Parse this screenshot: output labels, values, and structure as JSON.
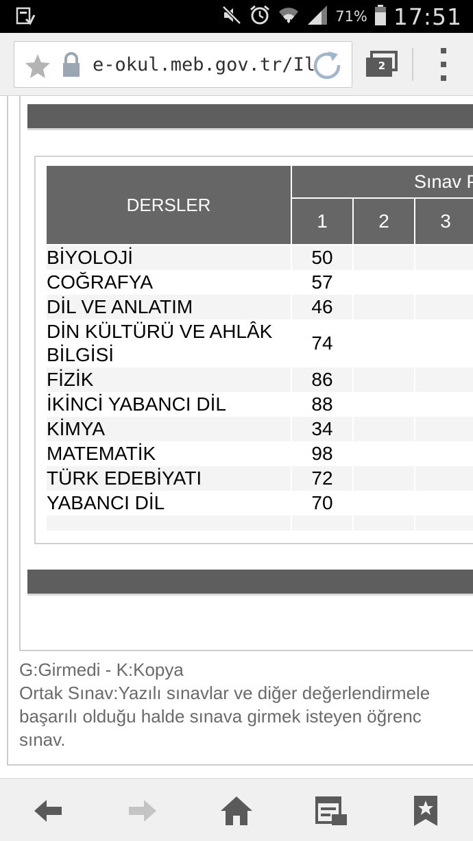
{
  "status_bar": {
    "battery_percent": "71%",
    "time": "17:51",
    "icons": [
      "screenshot-icon",
      "mute-icon",
      "alarm-icon",
      "wifi-icon",
      "signal-icon",
      "battery-icon"
    ]
  },
  "browser": {
    "url": "e-okul.meb.gov.tr/IlkÖ",
    "tab_count": "2",
    "icons": [
      "bookmark-star-icon",
      "lock-icon",
      "reload-icon",
      "tabs-icon",
      "overflow-menu-icon"
    ]
  },
  "grades_table": {
    "subject_header": "DERSLER",
    "exam_group_header": "Sınav P",
    "exam_columns": [
      "1",
      "2",
      "3"
    ],
    "rows": [
      {
        "subject": "BİYOLOJİ",
        "exam1": "50"
      },
      {
        "subject": "COĞRAFYA",
        "exam1": "57"
      },
      {
        "subject": "DİL VE ANLATIM",
        "exam1": "46"
      },
      {
        "subject": "DİN KÜLTÜRÜ VE AHLÂK BİLGİSİ",
        "exam1": "74"
      },
      {
        "subject": "FİZİK",
        "exam1": "86"
      },
      {
        "subject": "İKİNCİ YABANCI DİL",
        "exam1": "88"
      },
      {
        "subject": "KİMYA",
        "exam1": "34"
      },
      {
        "subject": "MATEMATİK",
        "exam1": "98"
      },
      {
        "subject": "TÜRK EDEBİYATI",
        "exam1": "72"
      },
      {
        "subject": "YABANCI DİL",
        "exam1": "70"
      }
    ]
  },
  "notes": {
    "legend": "G:Girmedi - K:Kopya",
    "line1": "Ortak Sınav:Yazılı sınavlar ve diğer değerlendirmele",
    "line2": "başarılı olduğu halde sınava girmek isteyen öğrenc",
    "line3": "sınav."
  },
  "bottom_nav": {
    "buttons": [
      "back-icon",
      "forward-icon",
      "home-icon",
      "reading-list-icon",
      "bookmarks-icon"
    ]
  },
  "colors": {
    "header_gray": "#666666",
    "band_gray": "#5e5e5e",
    "row_stripe": "#f4f4f4",
    "note_text": "#6a6a6a"
  }
}
